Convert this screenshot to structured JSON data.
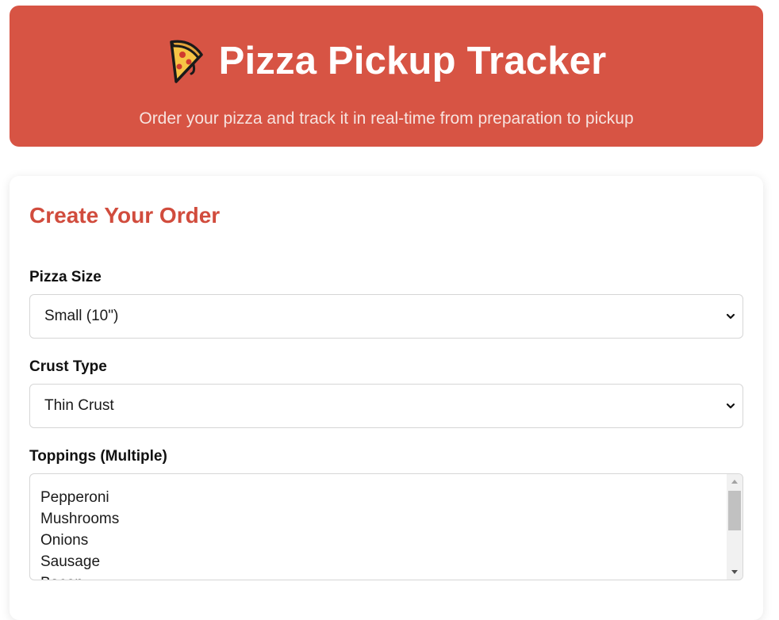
{
  "header": {
    "icon": "pizza-slice-icon",
    "title": "Pizza Pickup Tracker",
    "subtitle": "Order your pizza and track it in real-time from preparation to pickup"
  },
  "order_form": {
    "title": "Create Your Order",
    "size": {
      "label": "Pizza Size",
      "selected": "Small (10\")"
    },
    "crust": {
      "label": "Crust Type",
      "selected": "Thin Crust"
    },
    "toppings": {
      "label": "Toppings (Multiple)",
      "options": [
        "Pepperoni",
        "Mushrooms",
        "Onions",
        "Sausage",
        "Bacon"
      ]
    }
  },
  "colors": {
    "brand": "#d75444",
    "accent_text": "#d14c3d"
  }
}
